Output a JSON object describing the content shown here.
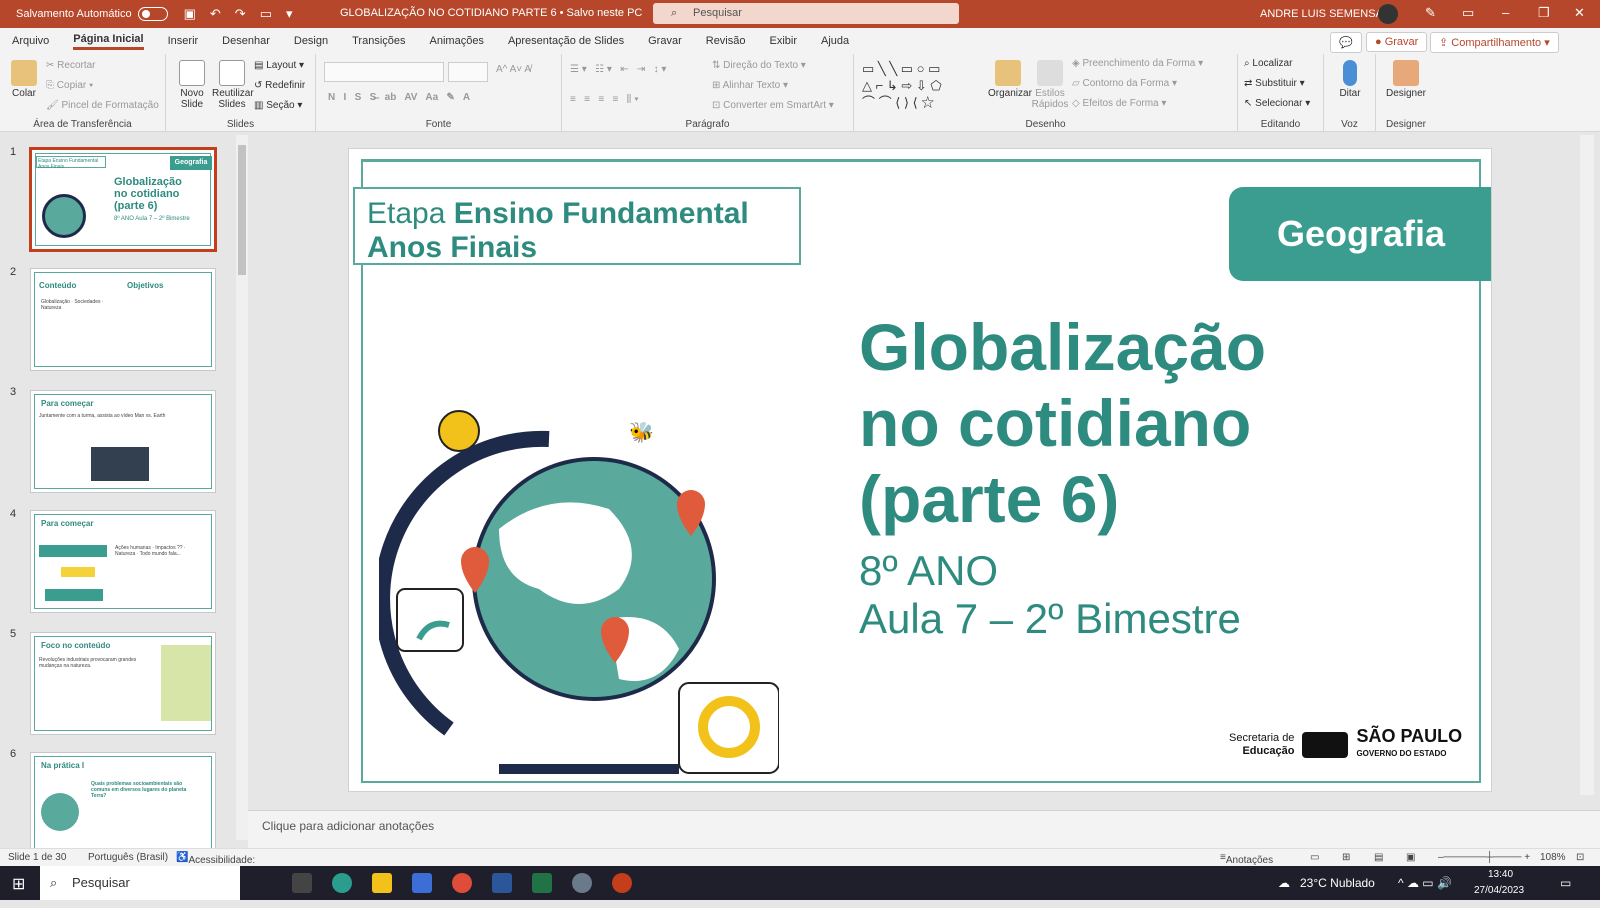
{
  "titlebar": {
    "autosave_label": "Salvamento Automático",
    "doc_title": "GLOBALIZAÇÃO NO COTIDIANO PARTE 6  •  Salvo neste PC",
    "search_placeholder": "Pesquisar",
    "user_name": "ANDRE LUIS SEMENSATO"
  },
  "menu": {
    "tabs": [
      "Arquivo",
      "Página Inicial",
      "Inserir",
      "Desenhar",
      "Design",
      "Transições",
      "Animações",
      "Apresentação de Slides",
      "Gravar",
      "Revisão",
      "Exibir",
      "Ajuda"
    ],
    "active": "Página Inicial",
    "record_button": "Gravar",
    "share_button": "Compartilhamento"
  },
  "ribbon": {
    "clipboard": {
      "label": "Área de Transferência",
      "paste": "Colar",
      "cut": "Recortar",
      "copy": "Copiar",
      "format_painter": "Pincel de Formatação"
    },
    "slides": {
      "label": "Slides",
      "new_slide": "Novo Slide",
      "reuse_slides": "Reutilizar Slides",
      "layout": "Layout",
      "reset": "Redefinir",
      "section": "Seção"
    },
    "font": {
      "label": "Fonte"
    },
    "paragraph": {
      "label": "Parágrafo",
      "text_direction": "Direção do Texto",
      "align_text": "Alinhar Texto",
      "smartart": "Converter em SmartArt"
    },
    "drawing": {
      "label": "Desenho",
      "arrange": "Organizar",
      "quick_styles": "Estilos Rápidos",
      "shape_fill": "Preenchimento da Forma",
      "shape_outline": "Contorno da Forma",
      "shape_effects": "Efeitos de Forma"
    },
    "editing": {
      "label": "Editando",
      "find": "Localizar",
      "replace": "Substituir",
      "select": "Selecionar"
    },
    "voice": {
      "label": "Voz",
      "dictate": "Ditar"
    },
    "designer": {
      "label": "Designer",
      "designer": "Designer"
    }
  },
  "thumbnails": [
    {
      "num": "1",
      "title": "Globalização no cotidiano (parte 6)",
      "sub": "8º ANO Aula 7 – 2º Bimestre"
    },
    {
      "num": "2",
      "title": "Conteúdo",
      "title2": "Objetivos",
      "body": "Globalização · Sociedades · Natureza"
    },
    {
      "num": "3",
      "title": "Para começar",
      "body": "Juntamente com a turma, assista ao vídeo Man vs. Earth"
    },
    {
      "num": "4",
      "title": "Para começar",
      "body": "Ações humanas · Impactos ?? · Natureza · Todo mundo fala..."
    },
    {
      "num": "5",
      "title": "Foco no conteúdo",
      "body": "Revoluções industriais provocaram grandes mudanças na natureza."
    },
    {
      "num": "6",
      "title": "Na prática I",
      "body": "Quais problemas socioambientais são comuns em diversos lugares do planeta Terra?"
    }
  ],
  "slide": {
    "etapa_prefix": "Etapa ",
    "etapa_bold": "Ensino Fundamental Anos Finais",
    "subject": "Geografia",
    "title": "Globalização no cotidiano (parte 6)",
    "grade": "8º ANO",
    "lesson": "Aula 7 – 2º Bimestre",
    "logo_text1": "Secretaria de",
    "logo_text2": "Educação",
    "logo_state": "SÃO PAULO",
    "logo_gov": "GOVERNO DO ESTADO"
  },
  "notes_placeholder": "Clique para adicionar anotações",
  "status": {
    "slide_info": "Slide 1 de 30",
    "language": "Português (Brasil)",
    "accessibility": "Acessibilidade: investigar",
    "notes_button": "Anotações",
    "zoom": "108%"
  },
  "taskbar": {
    "search_placeholder": "Pesquisar",
    "weather": "23°C  Nublado",
    "time": "13:40",
    "date": "27/04/2023"
  },
  "colors": {
    "accent": "#b7472a",
    "teal": "#3a9d8f"
  }
}
